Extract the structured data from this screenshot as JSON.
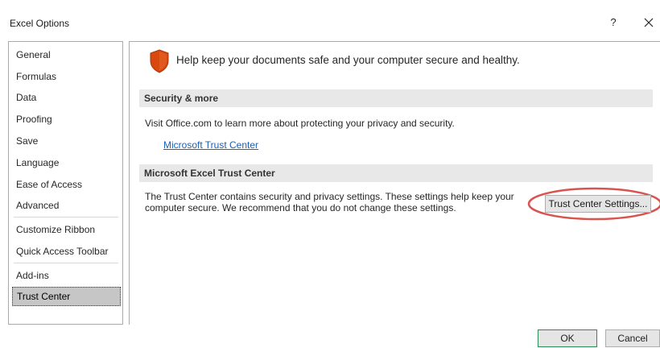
{
  "window": {
    "title": "Excel Options",
    "help_label": "?",
    "close_icon": "close-icon"
  },
  "sidebar": {
    "items": [
      {
        "label": "General"
      },
      {
        "label": "Formulas"
      },
      {
        "label": "Data"
      },
      {
        "label": "Proofing"
      },
      {
        "label": "Save"
      },
      {
        "label": "Language"
      },
      {
        "label": "Ease of Access"
      },
      {
        "label": "Advanced"
      },
      {
        "label": "Customize Ribbon"
      },
      {
        "label": "Quick Access Toolbar"
      },
      {
        "label": "Add-ins"
      },
      {
        "label": "Trust Center"
      }
    ],
    "selected": "Trust Center"
  },
  "main": {
    "headline": "Help keep your documents safe and your computer secure and healthy.",
    "headline_icon": "shield-icon",
    "security": {
      "header": "Security & more",
      "description": "Visit Office.com to learn more about protecting your privacy and security.",
      "link": "Microsoft Trust Center"
    },
    "trust_center": {
      "header": "Microsoft Excel Trust Center",
      "description_line1": "The Trust Center contains security and privacy settings. These settings help keep your",
      "description_line2": "computer secure. We recommend that you do not change these settings.",
      "button_label": "Trust Center Settings..."
    }
  },
  "footer": {
    "ok_label": "OK",
    "cancel_label": "Cancel"
  },
  "colors": {
    "shield": "#d9480f",
    "link": "#1b5fb8",
    "annotation": "#d9534f",
    "ok_border": "#2e8b57",
    "selected_bg": "#c6c6c6"
  }
}
